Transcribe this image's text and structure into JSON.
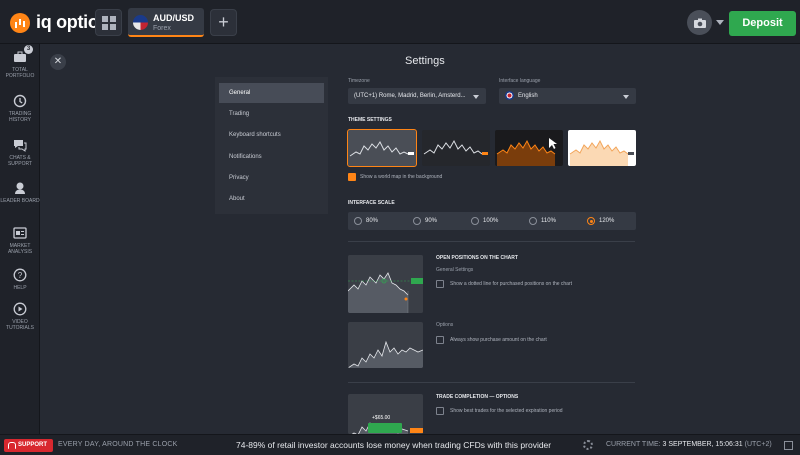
{
  "header": {
    "logo_text": "iq option",
    "asset": {
      "name": "AUD/USD",
      "type": "Forex"
    },
    "add_tab_label": "+",
    "deposit_label": "Deposit",
    "accent_color": "#ff8516",
    "deposit_color": "#2fa84f"
  },
  "sidebar": {
    "items": [
      {
        "label": "TOTAL PORTFOLIO",
        "icon": "briefcase-icon",
        "badge": "3"
      },
      {
        "label": "TRADING HISTORY",
        "icon": "history-icon"
      },
      {
        "label": "CHATS & SUPPORT",
        "icon": "chat-icon"
      },
      {
        "label": "LEADER BOARD",
        "icon": "leaderboard-icon"
      },
      {
        "label": "MARKET ANALYSIS",
        "icon": "market-analysis-icon"
      },
      {
        "label": "HELP",
        "icon": "help-icon"
      },
      {
        "label": "VIDEO TUTORIALS",
        "icon": "video-icon"
      }
    ]
  },
  "settings": {
    "title": "Settings",
    "close_label": "✕",
    "menu": [
      "General",
      "Trading",
      "Keyboard shortcuts",
      "Notifications",
      "Privacy",
      "About"
    ],
    "active_menu": "General",
    "timezone": {
      "label": "Timezone",
      "value": "(UTC+1) Rome, Madrid, Berlin, Amsterd..."
    },
    "language": {
      "label": "Interface language",
      "value": "English"
    },
    "theme_settings": {
      "title": "THEME SETTINGS",
      "themes": [
        "dark-grey",
        "dark-black",
        "dark-orange",
        "light"
      ],
      "selected_index": 0,
      "world_map_label": "Show a world map in the background",
      "world_map_checked": true
    },
    "interface_scale": {
      "title": "INTERFACE SCALE",
      "options": [
        "80%",
        "90%",
        "100%",
        "110%",
        "120%"
      ],
      "selected": "120%"
    },
    "open_positions": {
      "title": "OPEN POSITIONS ON THE CHART",
      "general_label": "General Settings",
      "dotted_line_label": "Show a dotted line for purchased positions on the chart",
      "options_label": "Options",
      "purchase_amount_label": "Always show purchase amount on the chart"
    },
    "trade_completion": {
      "title": "TRADE COMPLETION — OPTIONS",
      "best_trades_label": "Show best trades for the selected expiration period",
      "preview_amount": "+$65.00"
    }
  },
  "footer": {
    "support_label": "SUPPORT",
    "around_label": "EVERY DAY, AROUND THE CLOCK",
    "risk_warning": "74-89% of retail investor accounts lose money when trading CFDs with this provider",
    "time_label": "CURRENT TIME:",
    "time_value": "3 SEPTEMBER, 15:06:31",
    "timezone": "(UTC+2)"
  }
}
